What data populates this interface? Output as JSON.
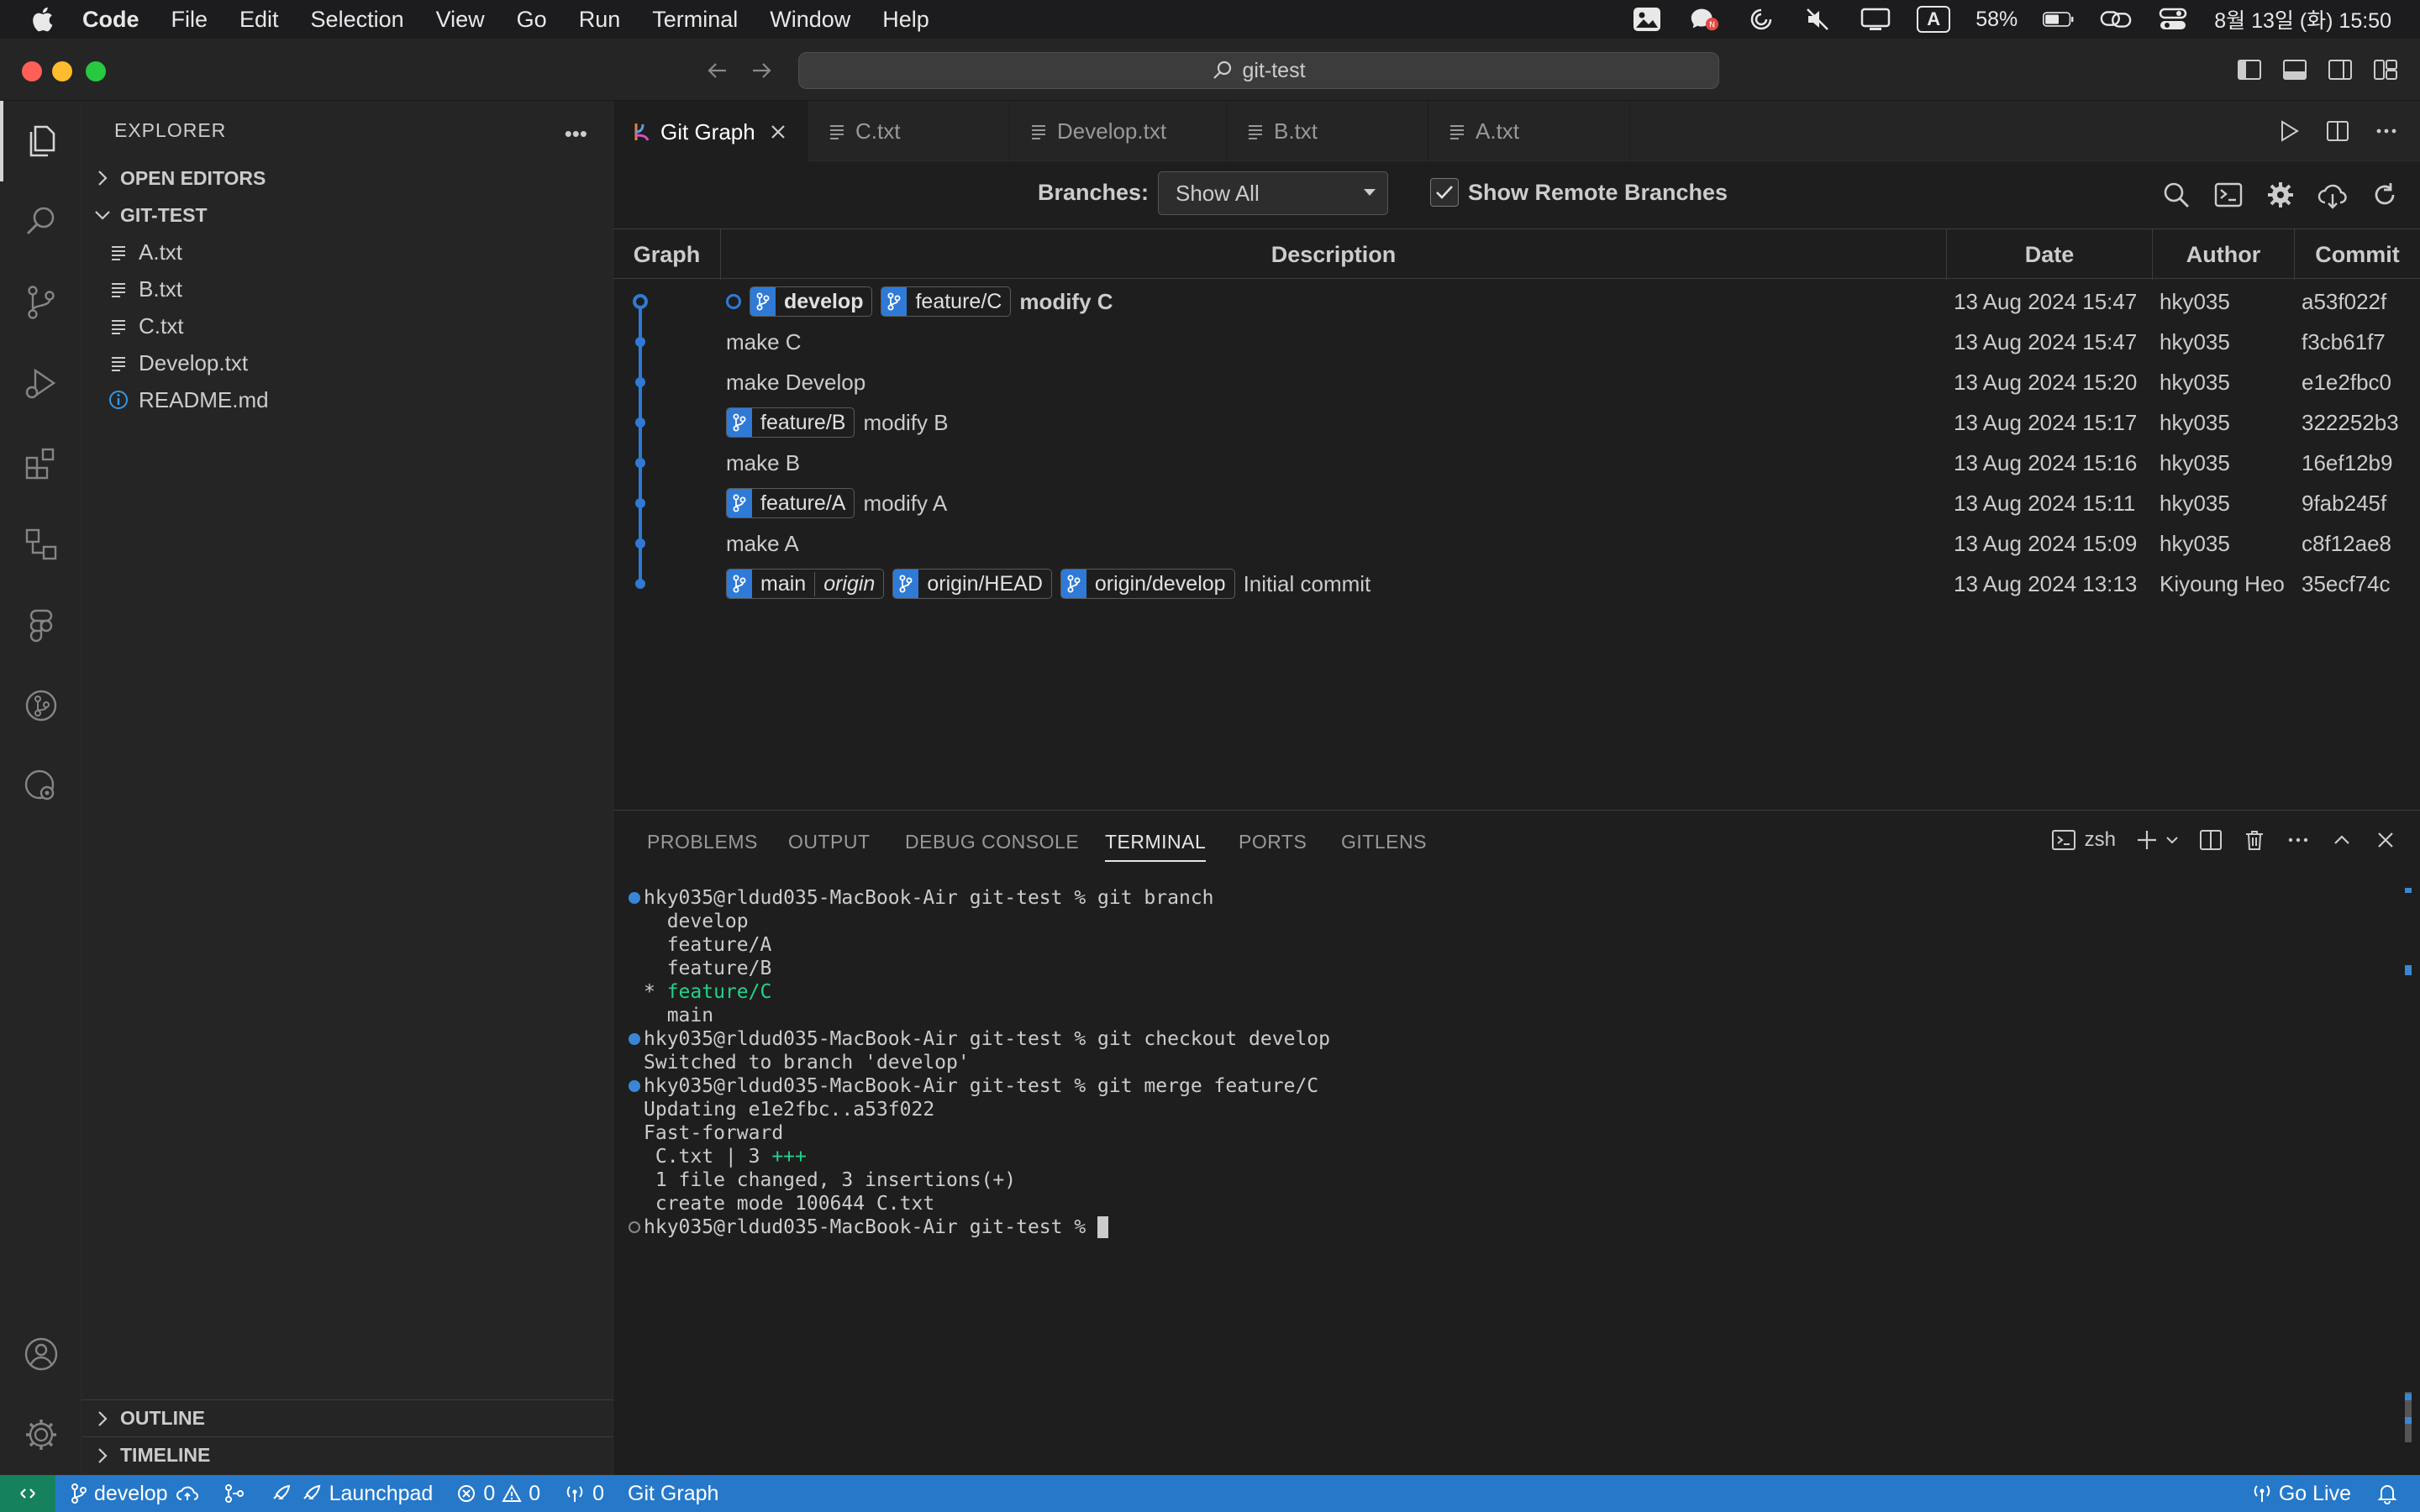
{
  "menubar": {
    "items": [
      "Code",
      "File",
      "Edit",
      "Selection",
      "View",
      "Go",
      "Run",
      "Terminal",
      "Window",
      "Help"
    ],
    "battery": "58%",
    "input_indicator": "A",
    "datetime": "8월 13일 (화) 15:50"
  },
  "titlebar": {
    "search_text": "git-test"
  },
  "sidebar": {
    "title": "EXPLORER",
    "open_editors": "OPEN EDITORS",
    "folder": "GIT-TEST",
    "files": [
      "A.txt",
      "B.txt",
      "C.txt",
      "Develop.txt",
      "README.md"
    ],
    "outline": "OUTLINE",
    "timeline": "TIMELINE"
  },
  "tabs": [
    "Git Graph",
    "C.txt",
    "Develop.txt",
    "B.txt",
    "A.txt"
  ],
  "gitgraph": {
    "branches_label": "Branches:",
    "branch_select": "Show All",
    "remote_label": "Show Remote Branches",
    "columns": [
      "Graph",
      "Description",
      "Date",
      "Author",
      "Commit"
    ],
    "rows": [
      {
        "refs": [
          {
            "name": "develop",
            "head": true
          },
          {
            "name": "feature/C"
          }
        ],
        "message": "modify C",
        "bold": true,
        "date": "13 Aug 2024 15:47",
        "author": "hky035",
        "commit": "a53f022f"
      },
      {
        "refs": [],
        "message": "make C",
        "date": "13 Aug 2024 15:47",
        "author": "hky035",
        "commit": "f3cb61f7"
      },
      {
        "refs": [],
        "message": "make Develop",
        "date": "13 Aug 2024 15:20",
        "author": "hky035",
        "commit": "e1e2fbc0"
      },
      {
        "refs": [
          {
            "name": "feature/B"
          }
        ],
        "message": "modify B",
        "date": "13 Aug 2024 15:17",
        "author": "hky035",
        "commit": "322252b3"
      },
      {
        "refs": [],
        "message": "make B",
        "date": "13 Aug 2024 15:16",
        "author": "hky035",
        "commit": "16ef12b9"
      },
      {
        "refs": [
          {
            "name": "feature/A"
          }
        ],
        "message": "modify A",
        "date": "13 Aug 2024 15:11",
        "author": "hky035",
        "commit": "9fab245f"
      },
      {
        "refs": [],
        "message": "make A",
        "date": "13 Aug 2024 15:09",
        "author": "hky035",
        "commit": "c8f12ae8"
      },
      {
        "refs": [
          {
            "name": "main",
            "remote": "origin"
          },
          {
            "name": "origin/HEAD"
          },
          {
            "name": "origin/develop"
          }
        ],
        "message": "Initial commit",
        "date": "13 Aug 2024 13:13",
        "author": "Kiyoung Heo",
        "commit": "35ecf74c"
      }
    ]
  },
  "panel": {
    "tabs": [
      "PROBLEMS",
      "OUTPUT",
      "DEBUG CONSOLE",
      "TERMINAL",
      "PORTS",
      "GITLENS"
    ],
    "active_tab": "TERMINAL",
    "shell": "zsh",
    "terminal_lines": [
      {
        "mark": "dot",
        "text": "hky035@rldud035-MacBook-Air git-test % git branch"
      },
      {
        "mark": "",
        "text": "  develop"
      },
      {
        "mark": "",
        "text": "  feature/A"
      },
      {
        "mark": "",
        "text": "  feature/B"
      },
      {
        "mark": "",
        "text": "* ",
        "green": "feature/C"
      },
      {
        "mark": "",
        "text": "  main"
      },
      {
        "mark": "dot",
        "text": "hky035@rldud035-MacBook-Air git-test % git checkout develop"
      },
      {
        "mark": "",
        "text": "Switched to branch 'develop'"
      },
      {
        "mark": "dot",
        "text": "hky035@rldud035-MacBook-Air git-test % git merge feature/C"
      },
      {
        "mark": "",
        "text": "Updating e1e2fbc..a53f022"
      },
      {
        "mark": "",
        "text": "Fast-forward"
      },
      {
        "mark": "",
        "text": " C.txt | 3 ",
        "green": "+++"
      },
      {
        "mark": "",
        "text": " 1 file changed, 3 insertions(+)"
      },
      {
        "mark": "",
        "text": " create mode 100644 C.txt"
      },
      {
        "mark": "ring",
        "text": "hky035@rldud035-MacBook-Air git-test % ",
        "cursor": true
      }
    ]
  },
  "statusbar": {
    "branch": "develop",
    "launchpad": "Launchpad",
    "errors": "0",
    "warnings": "0",
    "ports": "0",
    "gitgraph": "Git Graph",
    "golive": "Go Live"
  },
  "colors": {
    "accent": "#2678c9",
    "graph_line": "#2f7ad6",
    "terminal_green": "#23d18b"
  }
}
